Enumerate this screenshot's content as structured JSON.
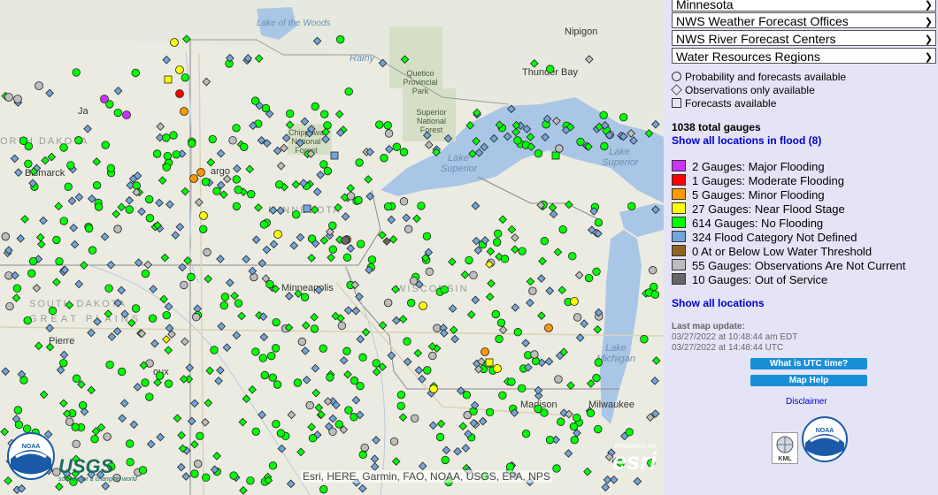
{
  "map": {
    "labels": {
      "lake_of_the_woods": "Lake of the Woods",
      "rainy": "Rainy",
      "nipigon": "Nipigon",
      "quetico": "Quetico Provincial Park",
      "thunder_bay": "Thunder Bay",
      "north_dakota": "ORTH DAKOTA",
      "bismarck": "Bismarck",
      "fargo": "argo",
      "chippewa": "Chippewa National Forest",
      "superior_nf": "Superior National Forest",
      "lake_superior_1": "Lake Superior",
      "lake_superior_2": "Lake Superior",
      "minnesota": "MINNESOTA",
      "south_dakota": "SOUTH DAKOTA",
      "great_plains": "GREAT PLAINS",
      "minneapolis": "Minneapolis",
      "wisconsin": "WISCONSIN",
      "pierre": "Pierre",
      "sioux": "oux",
      "lake_michigan": "Lake Michigan",
      "milwaukee": "Milwaukee",
      "madison": "Madison",
      "ja": "Ja"
    },
    "attribution": "Esri, HERE, Garmin, FAO, NOAA, USGS, EPA, NPS",
    "esri_powered": "POWERED BY",
    "esri_text": "esri",
    "usgs_text": "USGS",
    "usgs_tagline": "science for a changing world",
    "noaa_text": "NOAA"
  },
  "panel": {
    "selects": [
      {
        "value": "Minnesota"
      },
      {
        "value": "NWS Weather Forecast Offices"
      },
      {
        "value": "NWS River Forecast Centers"
      },
      {
        "value": "Water Resources Regions"
      }
    ],
    "legend_types": [
      {
        "label": "Probability and forecasts available",
        "shape": "circle"
      },
      {
        "label": "Observations only available",
        "shape": "diamond"
      },
      {
        "label": "Forecasts available",
        "shape": "square"
      }
    ],
    "total": "1038 total gauges",
    "flood_link": "Show all locations in flood (8)",
    "categories": [
      {
        "label": "2 Gauges: Major Flooding",
        "color": "#cc33ff"
      },
      {
        "label": "1 Gauges: Moderate Flooding",
        "color": "#ff0000"
      },
      {
        "label": "5 Gauges: Minor Flooding",
        "color": "#ff9900"
      },
      {
        "label": "27 Gauges: Near Flood Stage",
        "color": "#ffff00"
      },
      {
        "label": "614 Gauges: No Flooding",
        "color": "#00ff00"
      },
      {
        "label": "324 Flood Category Not Defined",
        "color": "#72a5d9"
      },
      {
        "label": "0 At or Below Low Water Threshold",
        "color": "#906320"
      },
      {
        "label": "55 Gauges: Observations Are Not Current",
        "color": "#bdbdbd"
      },
      {
        "label": "10 Gauges: Out of Service",
        "color": "#666666"
      }
    ],
    "all_link": "Show all locations",
    "update_label": "Last map update:",
    "update_edt": "03/27/2022 at 10:48:44 am EDT",
    "update_utc": "03/27/2022 at 14:48:44 UTC",
    "btn_utc": "What is UTC time?",
    "btn_help": "Map Help",
    "disclaimer": "Disclaimer",
    "kml_text": "KML",
    "noaa_text": "NOAA"
  }
}
